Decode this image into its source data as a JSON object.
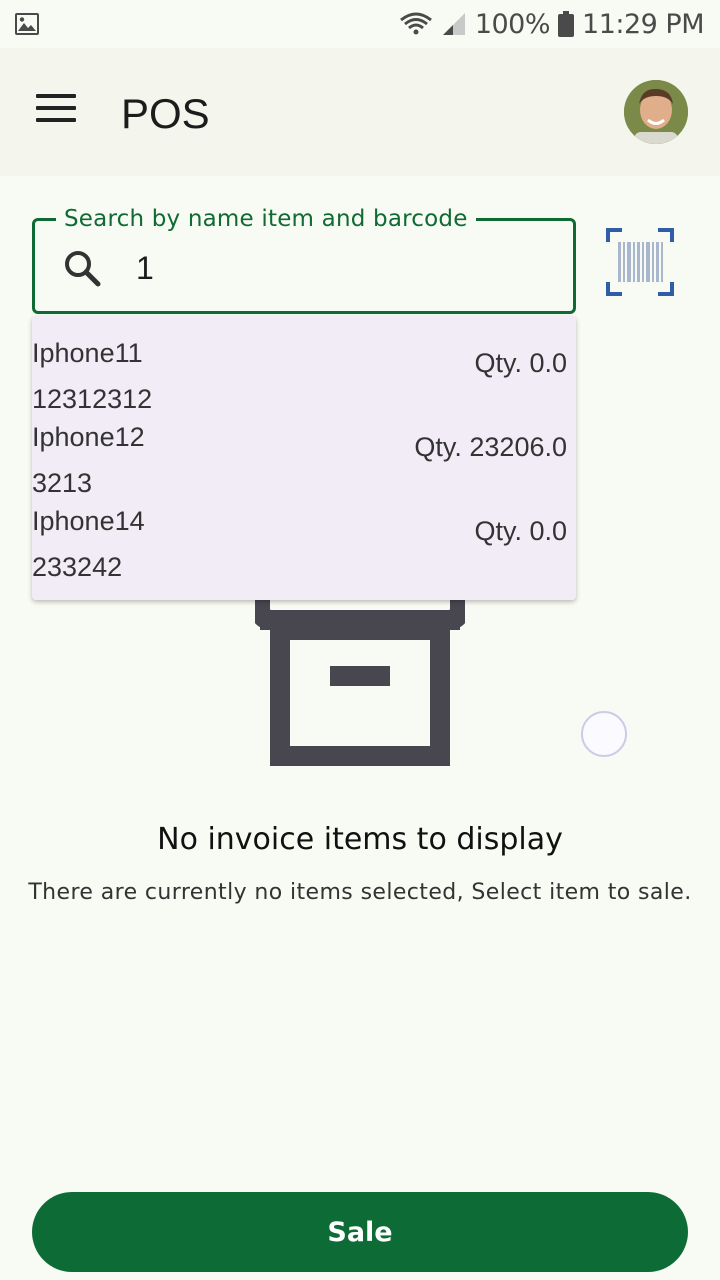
{
  "status_bar": {
    "battery": "100%",
    "time": "11:29 PM",
    "icons": [
      "gallery-icon",
      "wifi-icon",
      "signal-icon",
      "battery-icon"
    ]
  },
  "app_bar": {
    "title": "POS",
    "menu_icon": "menu-icon",
    "avatar_icon": "user-avatar"
  },
  "search": {
    "label": "Search by name item and barcode",
    "value": "1",
    "icon": "search-icon",
    "barcode_icon": "barcode-scan-icon"
  },
  "suggestions": [
    {
      "name": "Iphone11",
      "code": "12312312",
      "qty": "Qty. 0.0"
    },
    {
      "name": "Iphone12",
      "code": "3213",
      "qty": "Qty. 23206.0"
    },
    {
      "name": "Iphone14",
      "code": "233242",
      "qty": "Qty. 0.0"
    }
  ],
  "empty_state": {
    "icon": "archive-box-icon",
    "title": "No invoice items to display",
    "subtitle": "There are currently no items selected, Select item to sale."
  },
  "footer": {
    "sale_label": "Sale"
  },
  "colors": {
    "primary": "#0d6b35",
    "background": "#f8fbf3",
    "appbar": "#f4f5ed",
    "dropdown": "#f1ecf6",
    "icon_dark": "#48464f",
    "barcode_blue": "#2f5ea8"
  }
}
